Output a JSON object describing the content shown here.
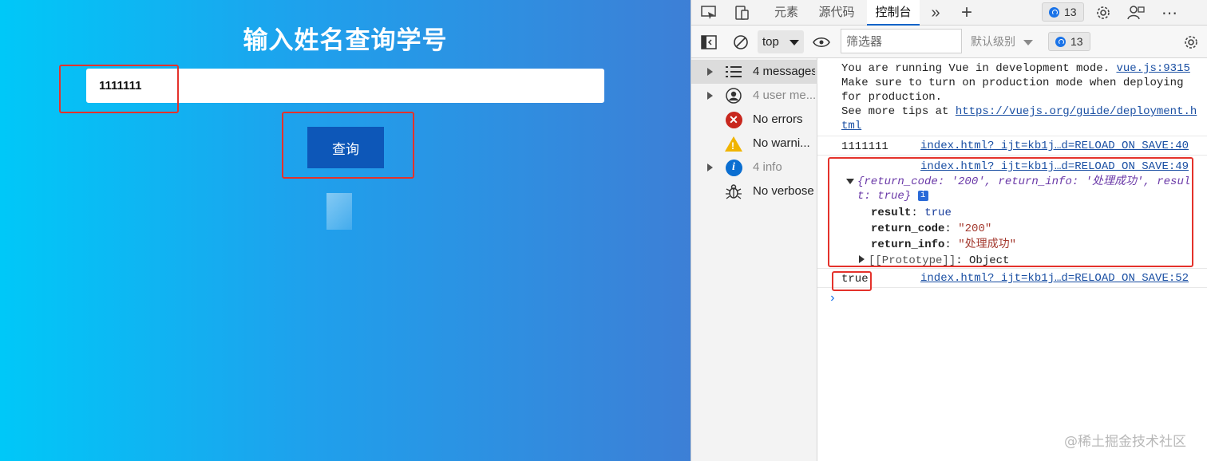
{
  "app": {
    "title": "输入姓名查询学号",
    "name_input_value": "1111111",
    "query_button_label": "查询"
  },
  "devtools": {
    "tabs": [
      "元素",
      "源代码",
      "控制台"
    ],
    "active_tab": "控制台",
    "issues_count": "13",
    "toolbar": {
      "context": "top",
      "filter_placeholder": "筛选器",
      "level": "默认级别",
      "issues_count": "13"
    },
    "sidebar": [
      {
        "label": "4 messages",
        "icon": "list-icon",
        "expandable": true,
        "selected": true
      },
      {
        "label": "4 user me...",
        "icon": "user-icon",
        "expandable": true,
        "selected": false
      },
      {
        "label": "No errors",
        "icon": "error-icon",
        "expandable": false,
        "selected": false
      },
      {
        "label": "No warni...",
        "icon": "warning-icon",
        "expandable": false,
        "selected": false
      },
      {
        "label": "4 info",
        "icon": "info-icon",
        "expandable": true,
        "selected": false
      },
      {
        "label": "No verbose",
        "icon": "bug-icon",
        "expandable": false,
        "selected": false
      }
    ],
    "console": {
      "vue_msg": {
        "line1": "You are running Vue in development mode.",
        "line1_link": "vue.js:9315",
        "line2": "Make sure to turn on production mode when deploying",
        "line3": "for production.",
        "line4": "See more tips at",
        "line4_link": "https://vuejs.org/guide/deployment.h",
        "line5_link": "tml"
      },
      "log1": {
        "value": "1111111",
        "source": "index.html?_ijt=kb1j…d=RELOAD_ON_SAVE:40"
      },
      "log2": {
        "source": "index.html?_ijt=kb1j…d=RELOAD_ON_SAVE:49",
        "preview_line1": "{return_code: '200', return_info: '处理成功', resul",
        "preview_line2": "t: true}",
        "props": [
          {
            "key": "result",
            "value": "true"
          },
          {
            "key": "return_code",
            "value": "\"200\""
          },
          {
            "key": "return_info",
            "value": "\"处理成功\""
          }
        ],
        "prototype_label": "[[Prototype]]",
        "prototype_value": "Object"
      },
      "log3": {
        "value": "true",
        "source": "index.html?_ijt=kb1j…d=RELOAD_ON_SAVE:52"
      },
      "prompt": "›"
    }
  },
  "watermark": "@稀土掘金技术社区",
  "colors": {
    "highlight": "#e4322b",
    "button": "#0d57b8",
    "link": "#1a4fa3"
  }
}
